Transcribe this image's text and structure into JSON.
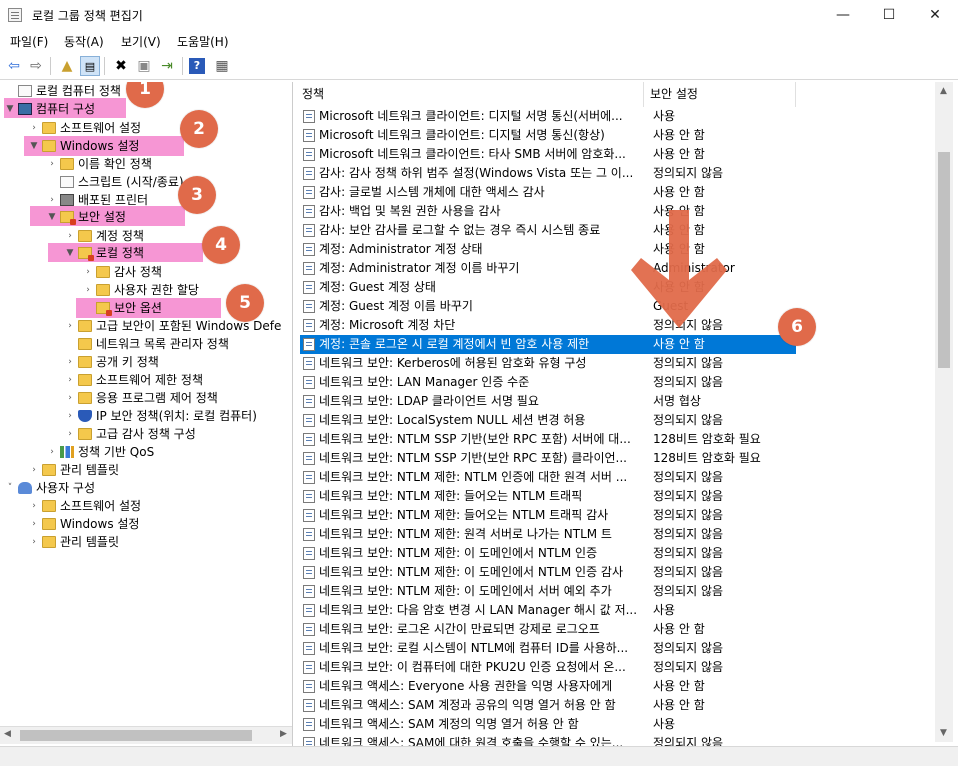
{
  "window": {
    "title": "로컬 그룹 정책 편집기",
    "buttons": {
      "minimize": "—",
      "maximize": "☐",
      "close": "✕"
    }
  },
  "menu": [
    "파일(F)",
    "동작(A)",
    "보기(V)",
    "도움말(H)"
  ],
  "tree": [
    {
      "label": "로컬 컴퓨터 정책",
      "icon": "document-icon"
    },
    {
      "label": "컴퓨터 구성",
      "icon": "computer-icon"
    },
    {
      "label": "소프트웨어 설정",
      "icon": "folder-icon"
    },
    {
      "label": "Windows 설정",
      "icon": "folder-icon"
    },
    {
      "label": "이름 확인 정책",
      "icon": "folder-icon"
    },
    {
      "label": "스크립트 (시작/종료)",
      "icon": "script-icon"
    },
    {
      "label": "배포된 프린터",
      "icon": "printer-icon"
    },
    {
      "label": "보안 설정",
      "icon": "security-folder-icon"
    },
    {
      "label": "계정 정책",
      "icon": "folder-icon"
    },
    {
      "label": "로컬 정책",
      "icon": "security-folder-icon"
    },
    {
      "label": "감사 정책",
      "icon": "folder-icon"
    },
    {
      "label": "사용자 권한 할당",
      "icon": "folder-icon"
    },
    {
      "label": "보안 옵션",
      "icon": "security-folder-icon"
    },
    {
      "label": "고급 보안이 포함된 Windows Defe",
      "icon": "folder-icon"
    },
    {
      "label": "네트워크 목록 관리자 정책",
      "icon": "folder-icon"
    },
    {
      "label": "공개 키 정책",
      "icon": "folder-icon"
    },
    {
      "label": "소프트웨어 제한 정책",
      "icon": "folder-icon"
    },
    {
      "label": "응용 프로그램 제어 정책",
      "icon": "folder-icon"
    },
    {
      "label": "IP 보안 정책(위치: 로컬 컴퓨터)",
      "icon": "shield-icon"
    },
    {
      "label": "고급 감사 정책 구성",
      "icon": "folder-icon"
    },
    {
      "label": "정책 기반 QoS",
      "icon": "chart-icon"
    },
    {
      "label": "관리 템플릿",
      "icon": "folder-icon"
    },
    {
      "label": "사용자 구성",
      "icon": "user-icon"
    },
    {
      "label": "소프트웨어 설정",
      "icon": "folder-icon"
    },
    {
      "label": "Windows 설정",
      "icon": "folder-icon"
    },
    {
      "label": "관리 템플릿",
      "icon": "folder-icon"
    }
  ],
  "list": {
    "columns": [
      "정책",
      "보안 설정"
    ],
    "rows": [
      {
        "policy": "Microsoft 네트워크 클라이언트: 디지털 서명 통신(서버에...",
        "setting": "사용"
      },
      {
        "policy": "Microsoft 네트워크 클라이언트: 디지털 서명 통신(항상)",
        "setting": "사용 안 함"
      },
      {
        "policy": "Microsoft 네트워크 클라이언트: 타사 SMB 서버에 암호화...",
        "setting": "사용 안 함"
      },
      {
        "policy": "감사: 감사 정책 하위 범주 설정(Windows Vista 또는 그 이...",
        "setting": "정의되지 않음"
      },
      {
        "policy": "감사: 글로벌 시스템 개체에 대한 액세스 감사",
        "setting": "사용 안 함"
      },
      {
        "policy": "감사: 백업 및 복원 권한 사용을 감사",
        "setting": "사용 안 함"
      },
      {
        "policy": "감사: 보안 감사를 로그할 수 없는 경우 즉시 시스템 종료",
        "setting": "사용 안 함"
      },
      {
        "policy": "계정: Administrator 계정 상태",
        "setting": "사용 안 함"
      },
      {
        "policy": "계정: Administrator 계정 이름 바꾸기",
        "setting": "Administrator"
      },
      {
        "policy": "계정: Guest 계정 상태",
        "setting": "사용 안 함"
      },
      {
        "policy": "계정: Guest 계정 이름 바꾸기",
        "setting": "Guest"
      },
      {
        "policy": "계정: Microsoft 계정 차단",
        "setting": "정의되지 않음"
      },
      {
        "policy": "계정: 콘솔 로그온 시 로컬 계정에서 빈 암호 사용 제한",
        "setting": "사용 안 함"
      },
      {
        "policy": "네트워크 보안: Kerberos에 허용된 암호화 유형 구성",
        "setting": "정의되지 않음"
      },
      {
        "policy": "네트워크 보안: LAN Manager 인증 수준",
        "setting": "정의되지 않음"
      },
      {
        "policy": "네트워크 보안: LDAP 클라이언트 서명 필요",
        "setting": "서명 협상"
      },
      {
        "policy": "네트워크 보안: LocalSystem NULL 세션 변경 허용",
        "setting": "정의되지 않음"
      },
      {
        "policy": "네트워크 보안: NTLM SSP 기반(보안 RPC 포함) 서버에 대...",
        "setting": "128비트 암호화 필요"
      },
      {
        "policy": "네트워크 보안: NTLM SSP 기반(보안 RPC 포함) 클라이언...",
        "setting": "128비트 암호화 필요"
      },
      {
        "policy": "네트워크 보안: NTLM 제한: NTLM 인증에 대한 원격 서버 ...",
        "setting": "정의되지 않음"
      },
      {
        "policy": "네트워크 보안: NTLM 제한: 들어오는 NTLM 트래픽",
        "setting": "정의되지 않음"
      },
      {
        "policy": "네트워크 보안: NTLM 제한: 들어오는 NTLM 트래픽 감사",
        "setting": "정의되지 않음"
      },
      {
        "policy": "네트워크 보안: NTLM 제한: 원격 서버로 나가는 NTLM 트",
        "setting": "정의되지 않음"
      },
      {
        "policy": "네트워크 보안: NTLM 제한: 이 도메인에서 NTLM 인증",
        "setting": "정의되지 않음"
      },
      {
        "policy": "네트워크 보안: NTLM 제한: 이 도메인에서 NTLM 인증 감사",
        "setting": "정의되지 않음"
      },
      {
        "policy": "네트워크 보안: NTLM 제한: 이 도메인에서 서버 예외 추가",
        "setting": "정의되지 않음"
      },
      {
        "policy": "네트워크 보안: 다음 암호 변경 시 LAN Manager 해시 값 저...",
        "setting": "사용"
      },
      {
        "policy": "네트워크 보안: 로그온 시간이 만료되면 강제로 로그오프",
        "setting": "사용 안 함"
      },
      {
        "policy": "네트워크 보안: 로컬 시스템이 NTLM에 컴퓨터 ID를 사용하...",
        "setting": "정의되지 않음"
      },
      {
        "policy": "네트워크 보안: 이 컴퓨터에 대한 PKU2U 인증 요청에서 온...",
        "setting": "정의되지 않음"
      },
      {
        "policy": "네트워크 액세스: Everyone 사용 권한을 익명 사용자에게",
        "setting": "사용 안 함"
      },
      {
        "policy": "네트워크 액세스: SAM 계정과 공유의 익명 열거 허용 안 함",
        "setting": "사용 안 함"
      },
      {
        "policy": "네트워크 액세스: SAM 계정의 익명 열거 허용 안 함",
        "setting": "사용"
      },
      {
        "policy": "네트워크 액세스: SAM에 대한 원격 호출을 수행할 수 있는...",
        "setting": "정의되지 않음"
      }
    ]
  },
  "annotations": [
    "1",
    "2",
    "3",
    "4",
    "5",
    "6"
  ],
  "colors": {
    "selection": "#0078d7",
    "highlight": "#f478c8",
    "marker": "#e06a4a"
  }
}
